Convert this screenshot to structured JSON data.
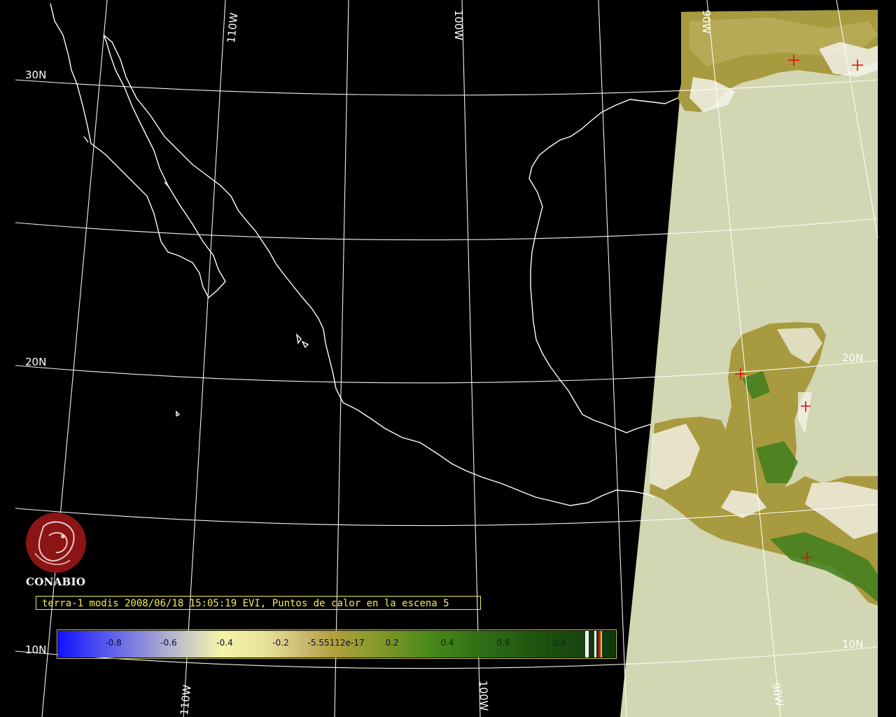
{
  "grid": {
    "lat_labels": [
      "30N",
      "20N",
      "10N"
    ],
    "lon_labels_top": [
      "110W",
      "100W",
      "90W"
    ],
    "lon_labels_right": [
      "20N",
      "10N"
    ],
    "lon_labels_bottom": [
      "110W",
      "100W",
      "90W"
    ]
  },
  "logo": {
    "name": "CONABIO"
  },
  "caption": {
    "text": "terra-1 modis 2008/06/18 15:05:19 EVI, Puntos de calor en la escena 5"
  },
  "colorbar": {
    "labels": [
      "-0.8",
      "-0.6",
      "-0.4",
      "-0.2",
      "-5.55112e-17",
      "0.2",
      "0.4",
      "0.6",
      "0.8"
    ]
  },
  "colors": {
    "background": "#000000",
    "water": "#d3d6b2",
    "land_vegetation": "#a89a3e",
    "grid_lines": "#ffffff",
    "caption": "#f2ec5a",
    "hotspot": "#e01010",
    "logo": "#8b1414"
  }
}
